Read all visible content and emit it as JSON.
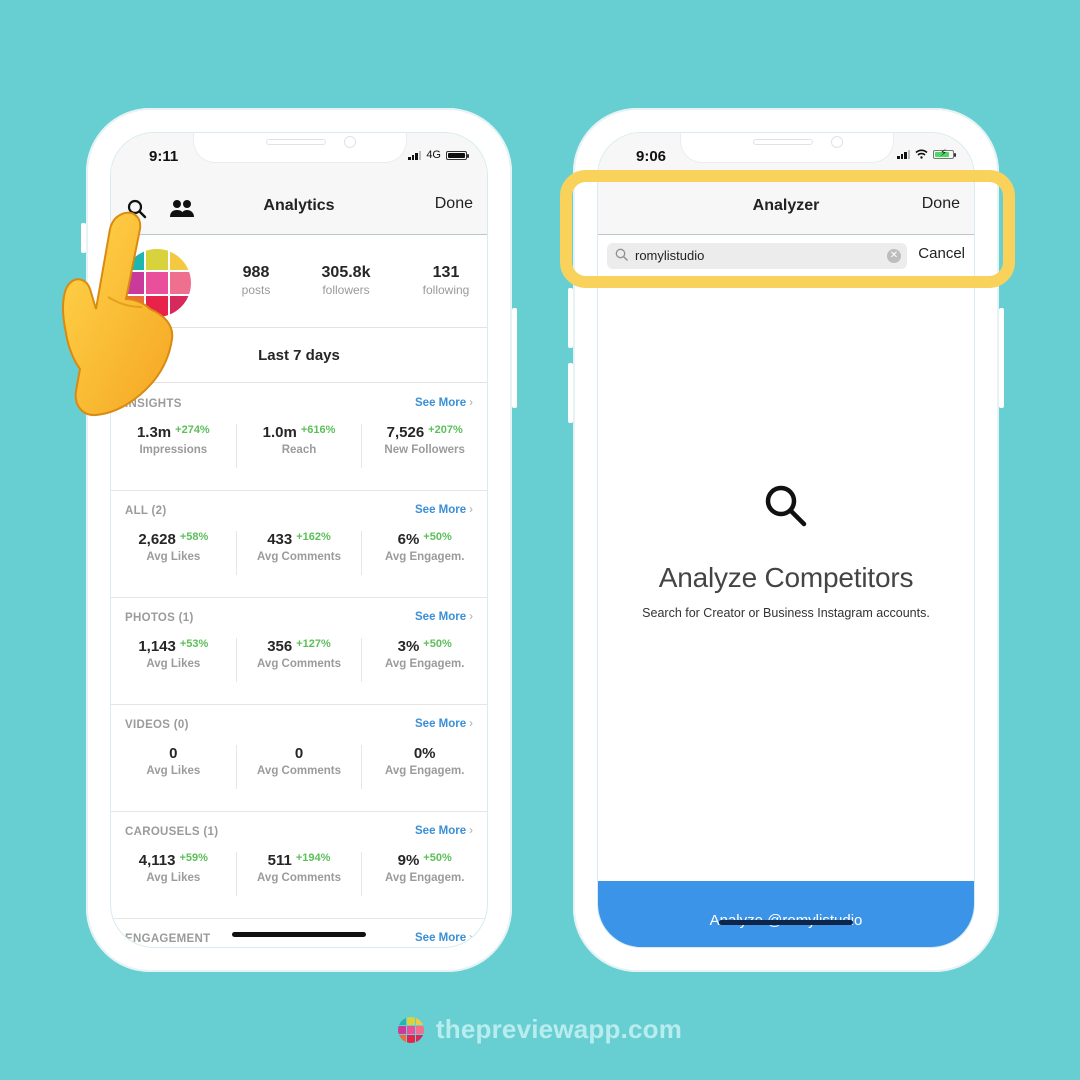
{
  "left_phone": {
    "status": {
      "time": "9:11",
      "network": "4G"
    },
    "nav": {
      "title": "Analytics",
      "done": "Done",
      "search_icon": "search-icon",
      "people_icon": "people-icon"
    },
    "profile": {
      "stats": [
        {
          "value": "988",
          "label": "posts"
        },
        {
          "value": "305.8k",
          "label": "followers"
        },
        {
          "value": "131",
          "label": "following"
        }
      ]
    },
    "period": "Last 7 days",
    "sections": [
      {
        "title": "INSIGHTS",
        "see_more": "See More",
        "metrics": [
          {
            "value": "1.3m",
            "change": "+274%",
            "label": "Impressions"
          },
          {
            "value": "1.0m",
            "change": "+616%",
            "label": "Reach"
          },
          {
            "value": "7,526",
            "change": "+207%",
            "label": "New Followers"
          }
        ]
      },
      {
        "title": "ALL (2)",
        "see_more": "See More",
        "metrics": [
          {
            "value": "2,628",
            "change": "+58%",
            "label": "Avg Likes"
          },
          {
            "value": "433",
            "change": "+162%",
            "label": "Avg Comments"
          },
          {
            "value": "6%",
            "change": "+50%",
            "label": "Avg Engagem."
          }
        ]
      },
      {
        "title": "PHOTOS (1)",
        "see_more": "See More",
        "metrics": [
          {
            "value": "1,143",
            "change": "+53%",
            "label": "Avg Likes"
          },
          {
            "value": "356",
            "change": "+127%",
            "label": "Avg Comments"
          },
          {
            "value": "3%",
            "change": "+50%",
            "label": "Avg Engagem."
          }
        ]
      },
      {
        "title": "VIDEOS (0)",
        "see_more": "See More",
        "metrics": [
          {
            "value": "0",
            "change": "",
            "label": "Avg Likes"
          },
          {
            "value": "0",
            "change": "",
            "label": "Avg Comments"
          },
          {
            "value": "0%",
            "change": "",
            "label": "Avg Engagem."
          }
        ]
      },
      {
        "title": "CAROUSELS (1)",
        "see_more": "See More",
        "metrics": [
          {
            "value": "4,113",
            "change": "+59%",
            "label": "Avg Likes"
          },
          {
            "value": "511",
            "change": "+194%",
            "label": "Avg Comments"
          },
          {
            "value": "9%",
            "change": "+50%",
            "label": "Avg Engagem."
          }
        ]
      },
      {
        "title": "ENGAGEMENT",
        "see_more": "See More",
        "metrics": []
      }
    ]
  },
  "right_phone": {
    "status": {
      "time": "9:06"
    },
    "nav": {
      "title": "Analyzer",
      "done": "Done"
    },
    "search": {
      "value": "romylistudio",
      "cancel": "Cancel"
    },
    "empty_state": {
      "title": "Analyze Competitors",
      "subtitle": "Search for Creator or Business Instagram accounts."
    },
    "action_button": "Analyze @romylistudio"
  },
  "footer": {
    "brand": "thepreviewapp.com"
  },
  "colors": {
    "background": "#67cfd2",
    "highlight": "#f9d25b",
    "link": "#3a8fd6",
    "positive": "#5cbf5a",
    "button": "#3c94e8",
    "avatar_grid": [
      "#1fb5b0",
      "#d8d23d",
      "#f5c842",
      "#c93a9b",
      "#e94f9a",
      "#ef6f8e",
      "#ef6c3a",
      "#e8224a",
      "#d62a5c"
    ]
  }
}
